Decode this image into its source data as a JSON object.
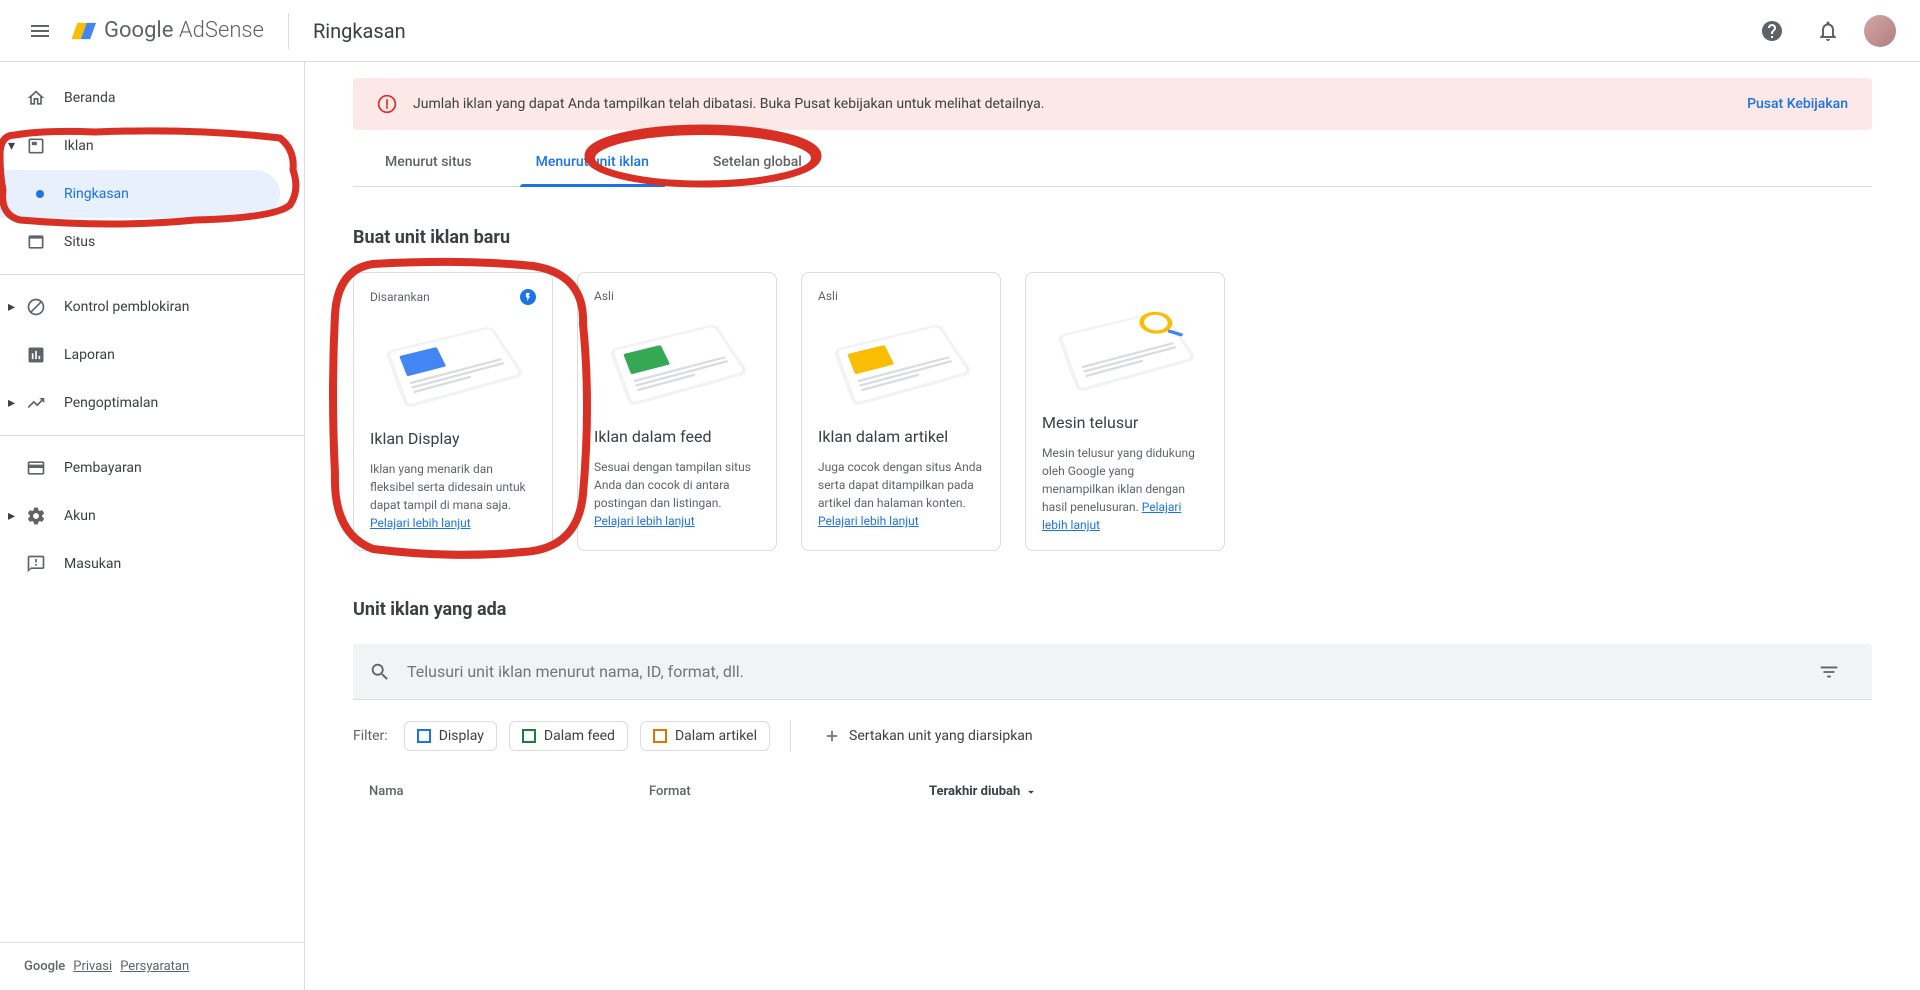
{
  "header": {
    "logo_product": "Google",
    "logo_suffix": "AdSense",
    "page_title": "Ringkasan"
  },
  "sidebar": {
    "items": [
      {
        "label": "Beranda"
      },
      {
        "label": "Iklan"
      },
      {
        "label": "Ringkasan"
      },
      {
        "label": "Situs"
      },
      {
        "label": "Kontrol pemblokiran"
      },
      {
        "label": "Laporan"
      },
      {
        "label": "Pengoptimalan"
      },
      {
        "label": "Pembayaran"
      },
      {
        "label": "Akun"
      },
      {
        "label": "Masukan"
      }
    ],
    "footer": {
      "brand": "Google",
      "privacy": "Privasi",
      "terms": "Persyaratan"
    }
  },
  "alert": {
    "text": "Jumlah iklan yang dapat Anda tampilkan telah dibatasi. Buka Pusat kebijakan untuk melihat detailnya.",
    "link": "Pusat Kebijakan"
  },
  "tabs": [
    {
      "label": "Menurut situs"
    },
    {
      "label": "Menurut unit iklan"
    },
    {
      "label": "Setelan global"
    }
  ],
  "sections": {
    "create_heading": "Buat unit iklan baru",
    "existing_heading": "Unit iklan yang ada"
  },
  "cards": [
    {
      "badge": "Disarankan",
      "title": "Iklan Display",
      "desc": "Iklan yang menarik dan fleksibel serta didesain untuk dapat tampil di mana saja.",
      "link": "Pelajari lebih lanjut"
    },
    {
      "badge": "Asli",
      "title": "Iklan dalam feed",
      "desc": "Sesuai dengan tampilan situs Anda dan cocok di antara postingan dan listingan.",
      "link": "Pelajari lebih lanjut"
    },
    {
      "badge": "Asli",
      "title": "Iklan dalam artikel",
      "desc": "Juga cocok dengan situs Anda serta dapat ditampilkan pada artikel dan halaman konten.",
      "link": "Pelajari lebih lanjut"
    },
    {
      "badge": "",
      "title": "Mesin telusur",
      "desc": "Mesin telusur yang didukung oleh Google yang menampilkan iklan dengan hasil penelusuran.",
      "link": "Pelajari lebih lanjut"
    }
  ],
  "search": {
    "placeholder": "Telusuri unit iklan menurut nama, ID, format, dll."
  },
  "filters": {
    "label": "Filter:",
    "chips": [
      {
        "label": "Display"
      },
      {
        "label": "Dalam feed"
      },
      {
        "label": "Dalam artikel"
      }
    ],
    "archive": "Sertakan unit yang diarsipkan"
  },
  "table": {
    "columns": {
      "name": "Nama",
      "format": "Format",
      "modified": "Terakhir diubah"
    }
  }
}
